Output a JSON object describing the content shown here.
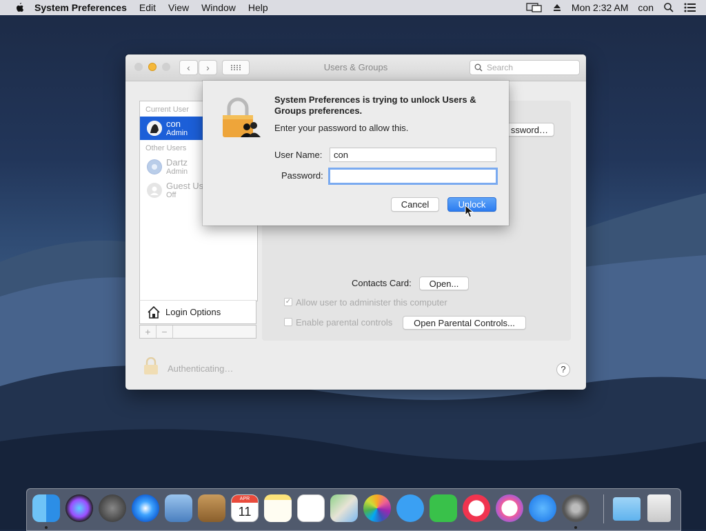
{
  "menubar": {
    "app_name": "System Preferences",
    "items": [
      "Edit",
      "View",
      "Window",
      "Help"
    ],
    "clock": "Mon 2:32 AM",
    "user": "con"
  },
  "window": {
    "title": "Users & Groups",
    "search_placeholder": "Search"
  },
  "sidebar": {
    "current_user_header": "Current User",
    "current_user": {
      "name": "con",
      "role": "Admin"
    },
    "other_users_header": "Other Users",
    "other_users": [
      {
        "name": "Dartz",
        "role": "Admin"
      },
      {
        "name": "Guest User",
        "role": "Off"
      }
    ],
    "login_options": "Login Options",
    "add_label": "+",
    "remove_label": "−"
  },
  "panel": {
    "change_password_partial": "ssword…",
    "contacts_card_label": "Contacts Card:",
    "open_button": "Open...",
    "allow_admin_label": "Allow user to administer this computer",
    "allow_admin_checked": true,
    "parental_label": "Enable parental controls",
    "parental_checked": false,
    "open_parental_button": "Open Parental Controls..."
  },
  "footer": {
    "status": "Authenticating…",
    "help_label": "?"
  },
  "dialog": {
    "heading": "System Preferences is trying to unlock Users & Groups preferences.",
    "subheading": "Enter your password to allow this.",
    "username_label": "User Name:",
    "username_value": "con",
    "password_label": "Password:",
    "password_value": "",
    "cancel_button": "Cancel",
    "unlock_button": "Unlock"
  },
  "dock": {
    "calendar_month": "APR",
    "calendar_day": "11",
    "apps": [
      "finder-icon",
      "siri-icon",
      "launchpad-icon",
      "safari-icon",
      "mail-icon",
      "contacts-icon",
      "calendar-icon",
      "notes-icon",
      "reminders-icon",
      "maps-icon",
      "photos-icon",
      "messages-icon",
      "facetime-icon",
      "news-icon",
      "music-icon",
      "app-store-icon",
      "system-preferences-icon",
      "downloads-folder-icon",
      "trash-icon"
    ]
  }
}
